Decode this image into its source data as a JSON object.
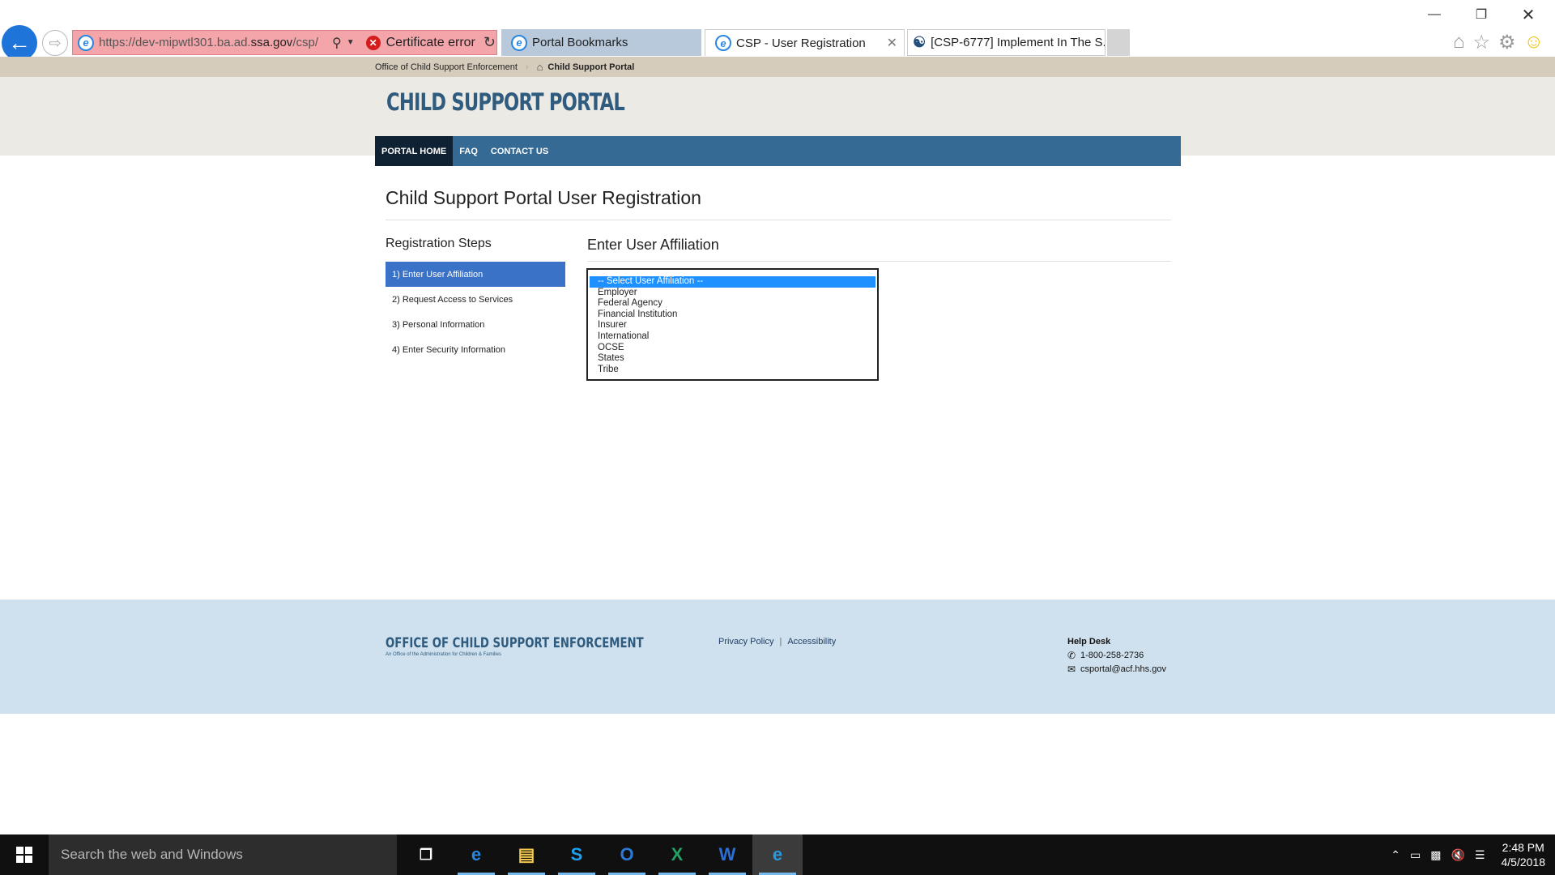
{
  "browser": {
    "url_prefix": "https://dev-mipwtl301.ba.ad.",
    "url_domain": "ssa.gov",
    "url_suffix": "/csp/",
    "cert_error": "Certificate error",
    "tabs": [
      {
        "label": "Portal Bookmarks"
      },
      {
        "label": "CSP - User Registration"
      },
      {
        "label": "[CSP-6777] Implement In The S..."
      }
    ]
  },
  "breadcrumb": {
    "parent": "Office of Child Support Enforcement",
    "current": "Child Support Portal"
  },
  "header": {
    "title": "CHILD SUPPORT PORTAL",
    "nav": [
      {
        "label": "PORTAL HOME"
      },
      {
        "label": "FAQ"
      },
      {
        "label": "CONTACT US"
      }
    ]
  },
  "main": {
    "page_title": "Child Support Portal User Registration",
    "steps_title": "Registration Steps",
    "steps": [
      {
        "label": "1) Enter User Affiliation"
      },
      {
        "label": "2) Request Access to Services"
      },
      {
        "label": "3) Personal Information"
      },
      {
        "label": "4) Enter Security Information"
      }
    ],
    "section_title": "Enter User Affiliation",
    "affiliation_options": [
      "-- Select User Affiliation --",
      "Employer",
      "Federal Agency",
      "Financial Institution",
      "Insurer",
      "International",
      "OCSE",
      "States",
      "Tribe"
    ]
  },
  "footer": {
    "logo_main": "OFFICE OF CHILD SUPPORT ENFORCEMENT",
    "logo_sub": "An Office of the Administration for Children & Families",
    "privacy": "Privacy Policy",
    "separator": "|",
    "accessibility": "Accessibility",
    "help_title": "Help Desk",
    "phone": "1-800-258-2736",
    "email": "csportal@acf.hhs.gov"
  },
  "taskbar": {
    "search_placeholder": "Search the web and Windows",
    "time": "2:48 PM",
    "date": "4/5/2018"
  },
  "colors": {
    "brand_blue": "#2f5b7e",
    "nav_bar": "#356a94",
    "nav_active": "#0f2233",
    "step_active": "#3a72c8",
    "footer_bg": "#cfe1ee",
    "cert_error_bg": "#f4a5aa"
  }
}
